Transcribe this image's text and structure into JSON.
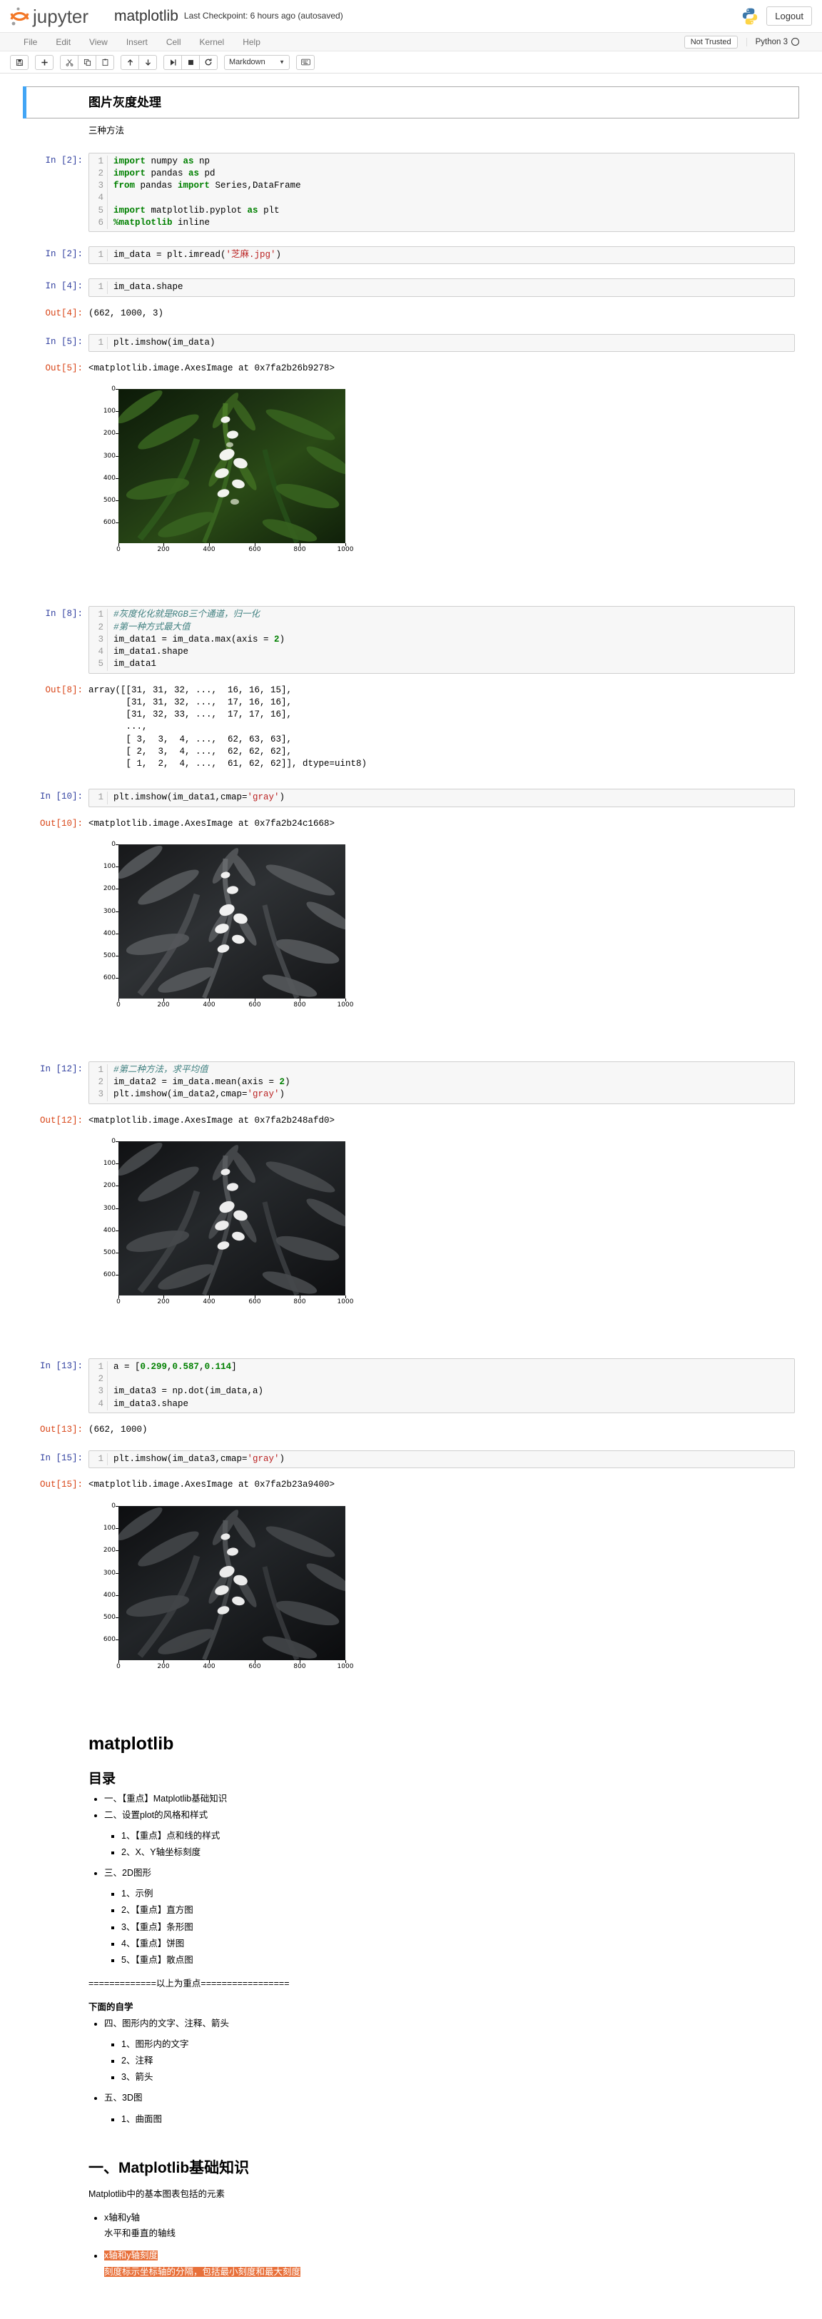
{
  "header": {
    "logo_text": "jupyter",
    "notebook_name": "matplotlib",
    "checkpoint": "Last Checkpoint: 6 hours ago (autosaved)",
    "logout_label": "Logout"
  },
  "menubar": {
    "items": [
      "File",
      "Edit",
      "View",
      "Insert",
      "Cell",
      "Kernel",
      "Help"
    ],
    "trusted_label": "Not Trusted",
    "kernel_name": "Python 3"
  },
  "toolbar": {
    "save_tip": "save-icon",
    "insert_tip": "plus-icon",
    "cut_tip": "scissors-icon",
    "copy_tip": "copy-icon",
    "paste_tip": "paste-icon",
    "up_tip": "arrow-up-icon",
    "down_tip": "arrow-down-icon",
    "run_tip": "run-icon",
    "stop_tip": "stop-icon",
    "restart_tip": "restart-icon",
    "cell_type": "Markdown",
    "keyboard_tip": "keyboard-icon"
  },
  "cells": {
    "title_md": "图片灰度处理",
    "subtitle_md": "三种方法",
    "c1": {
      "prompt": "In [2]:",
      "lines": [
        "1",
        "2",
        "3",
        "4",
        "5",
        "6"
      ],
      "code": "import numpy as np\nimport pandas as pd\nfrom pandas import Series,DataFrame\n\nimport matplotlib.pyplot as plt\n%matplotlib inline"
    },
    "c2": {
      "prompt": "In [2]:",
      "lines": [
        "1"
      ],
      "code": "im_data = plt.imread('芝麻.jpg')"
    },
    "c3": {
      "prompt": "In [4]:",
      "lines": [
        "1"
      ],
      "code": "im_data.shape",
      "out_prompt": "Out[4]:",
      "out": "(662, 1000, 3)"
    },
    "c4": {
      "prompt": "In [5]:",
      "lines": [
        "1"
      ],
      "code": "plt.imshow(im_data)",
      "out_prompt": "Out[5]:",
      "out": "<matplotlib.image.AxesImage at 0x7fa2b26b9278>"
    },
    "c5": {
      "prompt": "In [8]:",
      "lines": [
        "1",
        "2",
        "3",
        "4",
        "5"
      ],
      "code": "#灰度化化就是RGB三个通道，归一化\n#第一种方式最大值\nim_data1 = im_data.max(axis = 2)\nim_data1.shape\nim_data1",
      "out_prompt": "Out[8]:",
      "out": "array([[31, 31, 32, ...,  16, 16, 15],\n       [31, 31, 32, ...,  17, 16, 16],\n       [31, 32, 33, ...,  17, 17, 16],\n       ...,\n       [ 3,  3,  4, ...,  62, 63, 63],\n       [ 2,  3,  4, ...,  62, 62, 62],\n       [ 1,  2,  4, ...,  61, 62, 62]], dtype=uint8)"
    },
    "c6": {
      "prompt": "In [10]:",
      "lines": [
        "1"
      ],
      "code": "plt.imshow(im_data1,cmap='gray')",
      "out_prompt": "Out[10]:",
      "out": "<matplotlib.image.AxesImage at 0x7fa2b24c1668>"
    },
    "c7": {
      "prompt": "In [12]:",
      "lines": [
        "1",
        "2",
        "3"
      ],
      "code": "#第二种方法，求平均值\nim_data2 = im_data.mean(axis = 2)\nplt.imshow(im_data2,cmap='gray')",
      "out_prompt": "Out[12]:",
      "out": "<matplotlib.image.AxesImage at 0x7fa2b248afd0>"
    },
    "c8": {
      "prompt": "In [13]:",
      "lines": [
        "1",
        "2",
        "3",
        "4"
      ],
      "code": "a = [0.299,0.587,0.114]\n\nim_data3 = np.dot(im_data,a)\nim_data3.shape",
      "out_prompt": "Out[13]:",
      "out": "(662, 1000)"
    },
    "c9": {
      "prompt": "In [15]:",
      "lines": [
        "1"
      ],
      "code": "plt.imshow(im_data3,cmap='gray')",
      "out_prompt": "Out[15]:",
      "out": "<matplotlib.image.AxesImage at 0x7fa2b23a9400>"
    }
  },
  "figures": {
    "yticks": [
      "0",
      "100",
      "200",
      "300",
      "400",
      "500",
      "600"
    ],
    "xticks": [
      "0",
      "200",
      "400",
      "600",
      "800",
      "1000"
    ]
  },
  "markdown": {
    "h1_matplotlib": "matplotlib",
    "h2_toc": "目录",
    "toc": [
      {
        "label": "一、【重点】Matplotlib基础知识",
        "children": []
      },
      {
        "label": "二、设置plot的风格和样式",
        "children": [
          "1、【重点】点和线的样式",
          "2、X、Y轴坐标刻度"
        ]
      },
      {
        "label": "三、2D图形",
        "children": [
          "1、示例",
          "2、【重点】直方图",
          "3、【重点】条形图",
          "4、【重点】饼图",
          "5、【重点】散点图"
        ]
      }
    ],
    "divider": "=============以上为重点=================",
    "self_study_label": "下面的自学",
    "toc2": [
      {
        "label": "四、图形内的文字、注释、箭头",
        "children": [
          "1、图形内的文字",
          "2、注释",
          "3、箭头"
        ]
      },
      {
        "label": "五、3D图",
        "children": [
          "1、曲面图"
        ]
      }
    ],
    "h2_section1": "一、Matplotlib基础知识",
    "section1_intro": "Matplotlib中的基本图表包括的元素",
    "section1_items": [
      {
        "title": "x轴和y轴",
        "desc": "水平和垂直的轴线",
        "highlight": false
      },
      {
        "title": "x轴和y轴刻度",
        "desc": "刻度标示坐标轴的分隔，包括最小刻度和最大刻度",
        "highlight": true
      }
    ]
  },
  "colors": {
    "accent": "#42a5f5",
    "in_prompt": "#303f9f",
    "out_prompt": "#d84315",
    "highlight": "#e8703a"
  }
}
